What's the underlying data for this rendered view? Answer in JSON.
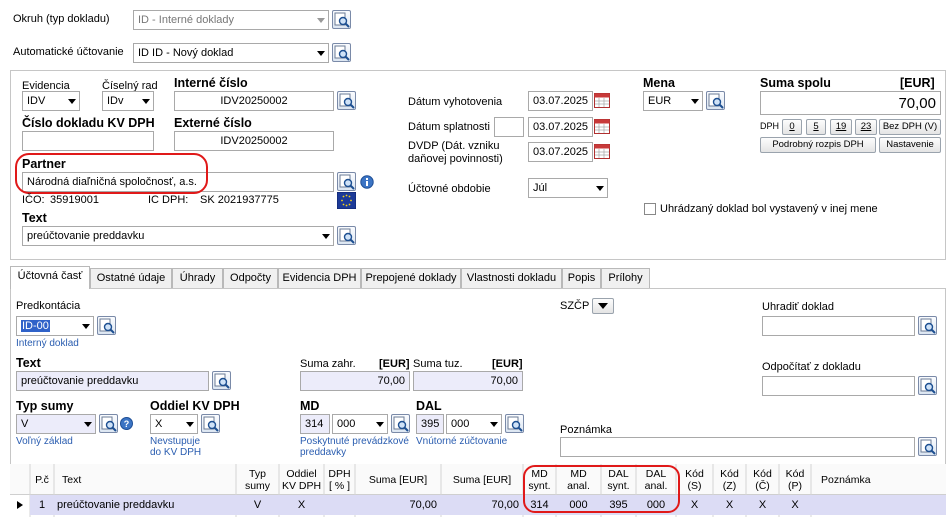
{
  "top": {
    "okruh_label": "Okruh (typ dokladu)",
    "okruh_value": "ID - Interné doklady",
    "auto_label": "Automatické účtovanie",
    "auto_value": "ID ID - Nový doklad"
  },
  "header": {
    "evidencia_label": "Evidencia",
    "evidencia_value": "IDV",
    "ciselny_label": "Číselný rad",
    "ciselny_value": "IDv",
    "interne_label": "Interné číslo",
    "interne_value": "IDV20250002",
    "kv_label": "Číslo dokladu KV DPH",
    "kv_value": "",
    "externe_label": "Externé číslo",
    "externe_value": "IDV20250002",
    "partner_label": "Partner",
    "partner_value": "Národná diaľničná spoločnosť, a.s.",
    "ico_label": "IČO:",
    "ico_value": "35919001",
    "icdph_label": "IC DPH:",
    "icdph_value": "SK 2021937775",
    "text_label": "Text",
    "text_value": "preúčtovanie preddavku",
    "datum_vyhot_label": "Dátum vyhotovenia",
    "datum_vyhot_value": "03.07.2025",
    "datum_splat_label": "Dátum splatnosti",
    "datum_splat_value": "03.07.2025",
    "dvdp_label_1": "DVDP (Dát. vzniku",
    "dvdp_label_2": "daňovej povinnosti)",
    "dvdp_value": "03.07.2025",
    "obdobie_label": "Účtovné obdobie",
    "obdobie_value": "Júl",
    "mena_label": "Mena",
    "mena_value": "EUR",
    "suma_label": "Suma spolu",
    "suma_unit": "[EUR]",
    "suma_value": "70,00",
    "dph_label": "DPH",
    "dph_buttons": [
      "0",
      "5",
      "19",
      "23"
    ],
    "bez_dph": "Bez DPH (V)",
    "rozpis_button": "Podrobný rozpis DPH",
    "nastavenie_button": "Nastavenie",
    "uhradzany_label": "Uhrádzaný doklad bol vystavený v inej mene"
  },
  "tabs": [
    "Účtovná časť",
    "Ostatné údaje",
    "Úhrady",
    "Odpočty",
    "Evidencia DPH",
    "Prepojené doklady",
    "Vlastnosti dokladu",
    "Popis",
    "Prílohy"
  ],
  "ucto": {
    "predkontacia_label": "Predkontácia",
    "predkontacia_value": "ID-00",
    "predkontacia_link": "Interný doklad",
    "szcp_label": "SZČP",
    "uhradit_label": "Uhradiť doklad",
    "odpocitat_label": "Odpočítať z dokladu",
    "text_label": "Text",
    "text_value": "preúčtovanie preddavku",
    "suma_zahr_label": "Suma zahr.",
    "suma_zahr_unit": "[EUR]",
    "suma_zahr_value": "70,00",
    "suma_tuz_label": "Suma tuz.",
    "suma_tuz_unit": "[EUR]",
    "suma_tuz_value": "70,00",
    "typ_sumy_label": "Typ sumy",
    "typ_sumy_value": "V",
    "typ_sumy_link": "Voľný základ",
    "oddiel_label": "Oddiel KV DPH",
    "oddiel_value": "X",
    "oddiel_link_1": "Nevstupuje",
    "oddiel_link_2": "do KV DPH",
    "md_label": "MD",
    "md_synt": "314",
    "md_anal": "000",
    "md_link_1": "Poskytnuté prevádzkové",
    "md_link_2": "preddavky",
    "dal_label": "DAL",
    "dal_synt": "395",
    "dal_anal": "000",
    "dal_link": "Vnútorné zúčtovanie",
    "poznamka_label": "Poznámka"
  },
  "grid": {
    "headers": {
      "pc": "P.č",
      "text": "Text",
      "typ_1": "Typ",
      "typ_2": "sumy",
      "oddiel_1": "Oddiel",
      "oddiel_2": "KV DPH",
      "dph_1": "DPH",
      "dph_2": "[ % ]",
      "suma1": "Suma [EUR]",
      "suma2": "Suma [EUR]",
      "mds_1": "MD",
      "mds_2": "synt.",
      "mda_1": "MD",
      "mda_2": "anal.",
      "dals_1": "DAL",
      "dals_2": "synt.",
      "dala_1": "DAL",
      "dala_2": "anal.",
      "ks_1": "Kód",
      "ks_2": "(S)",
      "kz_1": "Kód",
      "kz_2": "(Z)",
      "kc_1": "Kód",
      "kc_2": "(Č)",
      "kp_1": "Kód",
      "kp_2": "(P)",
      "poznamka": "Poznámka"
    },
    "row": {
      "pc": "1",
      "text": "preúčtovanie preddavku",
      "typ": "V",
      "oddiel": "X",
      "suma1": "70,00",
      "suma2": "70,00",
      "md_synt": "314",
      "md_anal": "000",
      "dal_synt": "395",
      "dal_anal": "000",
      "ks": "X",
      "kz": "X",
      "kc": "X",
      "kp": "X"
    }
  }
}
